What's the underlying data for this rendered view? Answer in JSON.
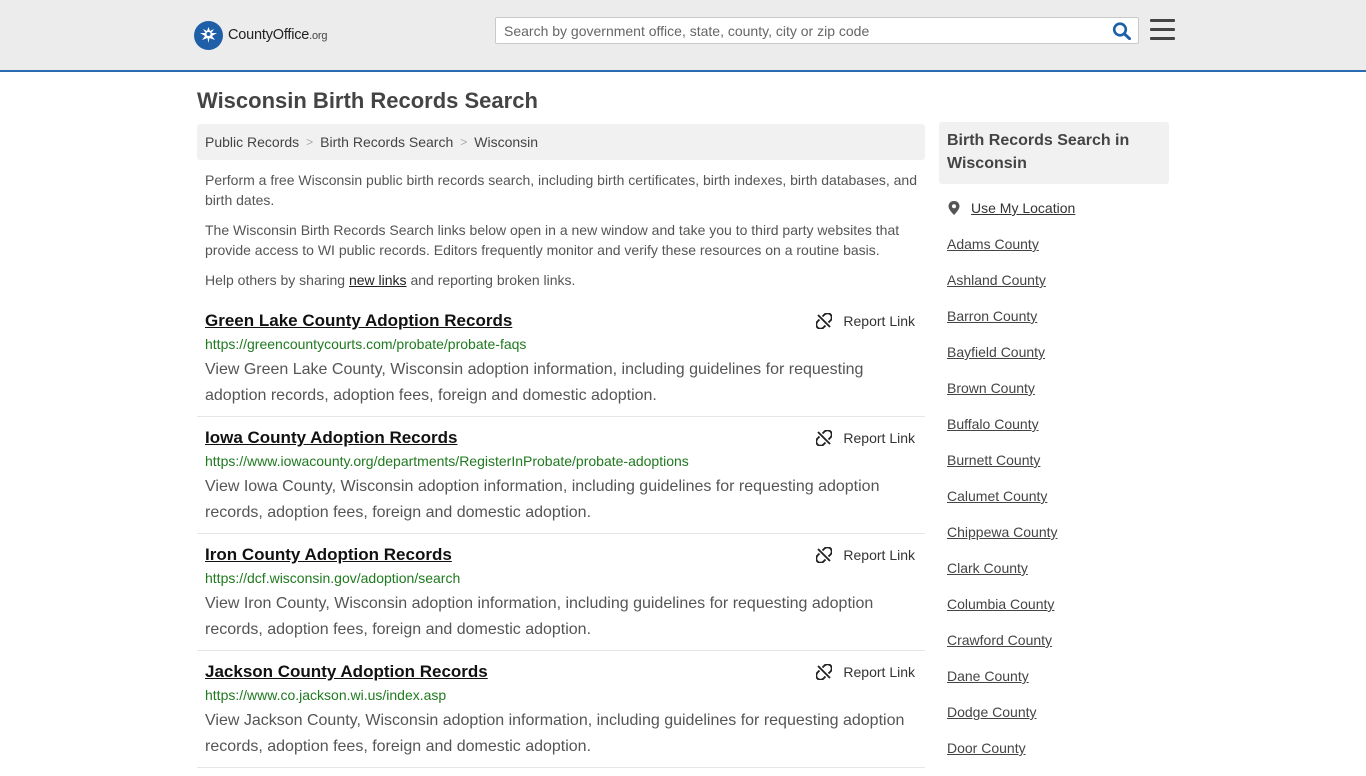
{
  "header": {
    "logo_main": "CountyOffice",
    "logo_suffix": ".org",
    "search_placeholder": "Search by government office, state, county, city or zip code",
    "search_value": ""
  },
  "page_title": "Wisconsin Birth Records Search",
  "breadcrumb": [
    {
      "label": "Public Records"
    },
    {
      "label": "Birth Records Search"
    },
    {
      "label": "Wisconsin"
    }
  ],
  "intro": {
    "p1": "Perform a free Wisconsin public birth records search, including birth certificates, birth indexes, birth databases, and birth dates.",
    "p2": "The Wisconsin Birth Records Search links below open in a new window and take you to third party websites that provide access to WI public records. Editors frequently monitor and verify these resources on a routine basis.",
    "p3_before": "Help others by sharing ",
    "p3_link": "new links",
    "p3_after": " and reporting broken links."
  },
  "report_label": "Report Link",
  "results": [
    {
      "title": "Green Lake County Adoption Records",
      "url": "https://greencountycourts.com/probate/probate-faqs",
      "desc": "View Green Lake County, Wisconsin adoption information, including guidelines for requesting adoption records, adoption fees, foreign and domestic adoption."
    },
    {
      "title": "Iowa County Adoption Records",
      "url": "https://www.iowacounty.org/departments/RegisterInProbate/probate-adoptions",
      "desc": "View Iowa County, Wisconsin adoption information, including guidelines for requesting adoption records, adoption fees, foreign and domestic adoption."
    },
    {
      "title": "Iron County Adoption Records",
      "url": "https://dcf.wisconsin.gov/adoption/search",
      "desc": "View Iron County, Wisconsin adoption information, including guidelines for requesting adoption records, adoption fees, foreign and domestic adoption."
    },
    {
      "title": "Jackson County Adoption Records",
      "url": "https://www.co.jackson.wi.us/index.asp",
      "desc": "View Jackson County, Wisconsin adoption information, including guidelines for requesting adoption records, adoption fees, foreign and domestic adoption."
    }
  ],
  "sidebar": {
    "heading": "Birth Records Search in Wisconsin",
    "use_location": "Use My Location",
    "counties": [
      "Adams County",
      "Ashland County",
      "Barron County",
      "Bayfield County",
      "Brown County",
      "Buffalo County",
      "Burnett County",
      "Calumet County",
      "Chippewa County",
      "Clark County",
      "Columbia County",
      "Crawford County",
      "Dane County",
      "Dodge County",
      "Door County"
    ]
  },
  "colors": {
    "brand_blue": "#1f5fa8",
    "url_green": "#1f7a1f",
    "header_bg": "#ececec"
  }
}
